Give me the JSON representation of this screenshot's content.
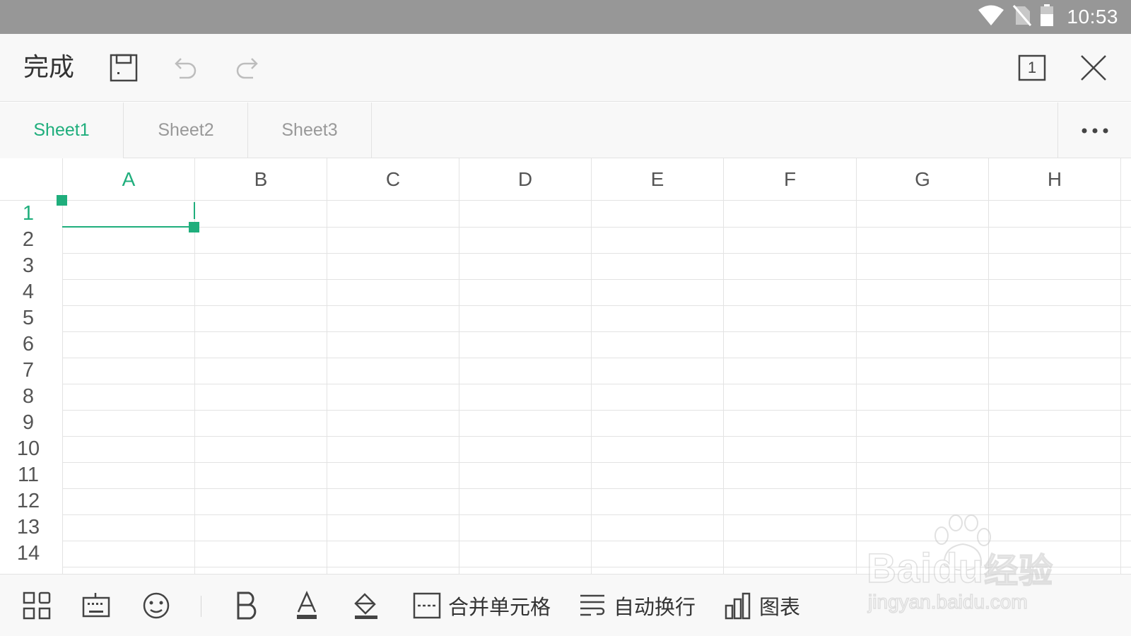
{
  "status_bar": {
    "time": "10:53",
    "icons": [
      "wifi-icon",
      "no-sim-icon",
      "battery-icon"
    ]
  },
  "toolbar": {
    "done_label": "完成",
    "icons": [
      "save-icon",
      "undo-icon",
      "redo-icon",
      "sheet-count-icon",
      "close-icon"
    ],
    "sheet_count": "1"
  },
  "sheet_tabs": [
    {
      "label": "Sheet1",
      "active": true
    },
    {
      "label": "Sheet2",
      "active": false
    },
    {
      "label": "Sheet3",
      "active": false
    }
  ],
  "grid": {
    "columns": [
      "A",
      "B",
      "C",
      "D",
      "E",
      "F",
      "G",
      "H"
    ],
    "rows": [
      "1",
      "2",
      "3",
      "4",
      "5",
      "6",
      "7",
      "8",
      "9",
      "10",
      "11",
      "12",
      "13",
      "14"
    ],
    "selected_cell": "A1"
  },
  "bottom_toolbar": {
    "icons": [
      "apps-icon",
      "keyboard-icon",
      "emoji-icon",
      "bold-icon",
      "font-color-icon",
      "fill-color-icon"
    ],
    "merge_cells_label": "合并单元格",
    "wrap_text_label": "自动换行",
    "chart_label": "图表"
  },
  "watermark": {
    "brand": "Baidu",
    "suffix": "经验",
    "url": "jingyan.baidu.com"
  },
  "colors": {
    "accent": "#1fae7c",
    "status_bar": "#979797",
    "toolbar_bg": "#f8f8f8",
    "grid_line": "#e3e3e3"
  }
}
